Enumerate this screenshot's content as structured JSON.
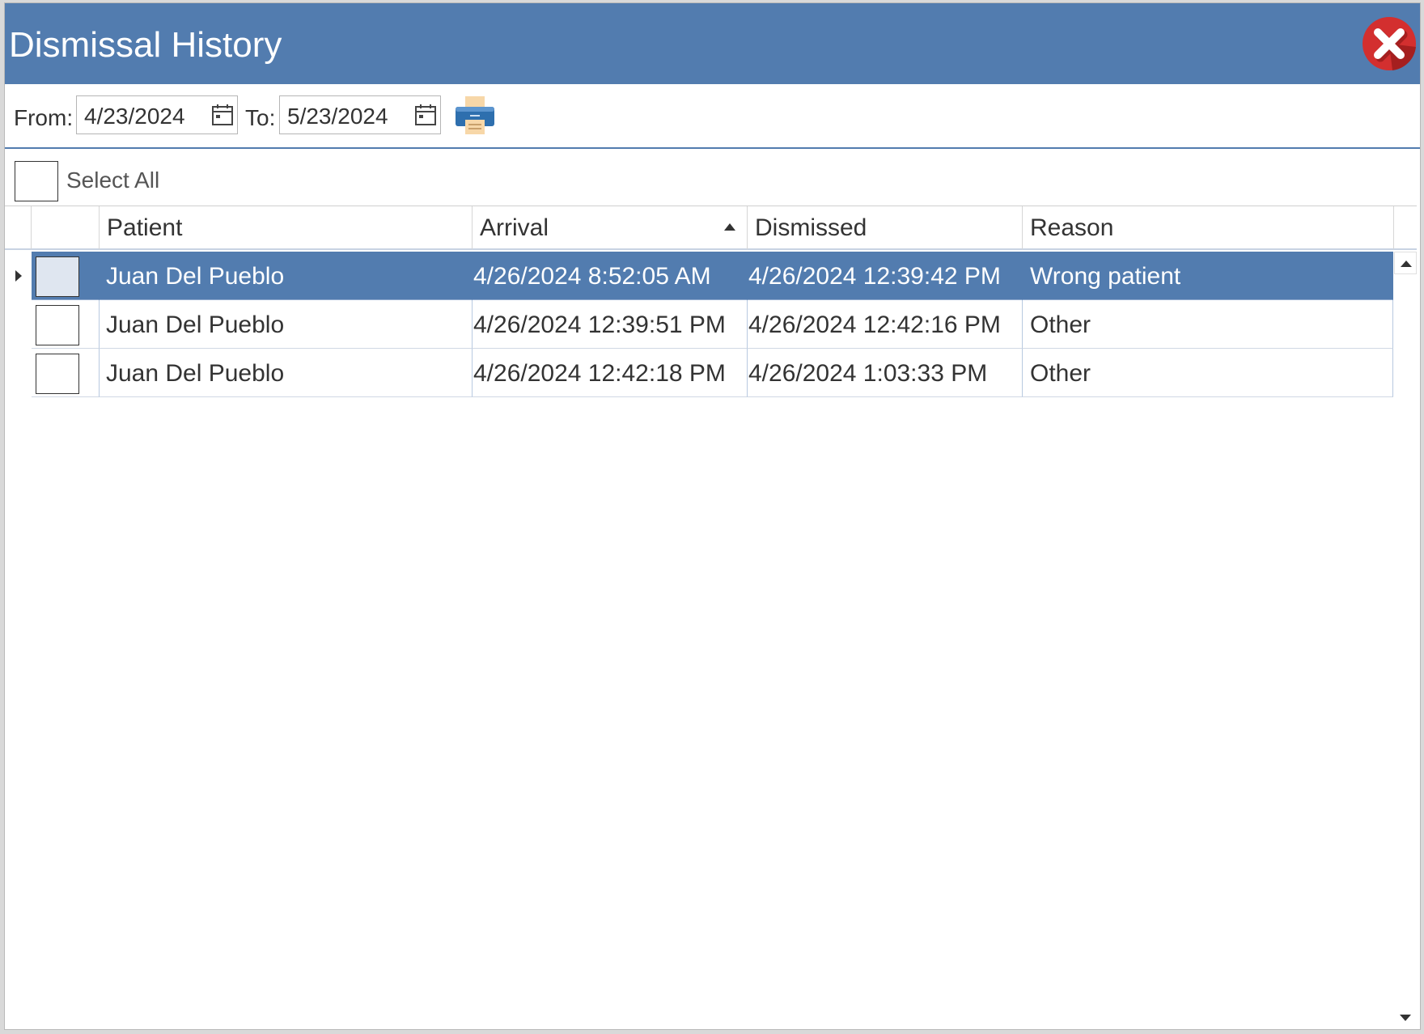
{
  "window": {
    "title": "Dismissal History"
  },
  "filters": {
    "from_label": "From:",
    "from_value": "4/23/2024",
    "to_label": "To:",
    "to_value": "5/23/2024"
  },
  "select_all_label": "Select All",
  "table": {
    "columns": [
      "Patient",
      "Arrival",
      "Dismissed",
      "Reason"
    ],
    "sorted_column": "Arrival",
    "sort_direction": "ascending",
    "rows": [
      {
        "patient": "Juan Del Pueblo",
        "arrival": "4/26/2024 8:52:05 AM",
        "dismissed": "4/26/2024 12:39:42 PM",
        "reason": "Wrong patient",
        "selected": true
      },
      {
        "patient": "Juan Del Pueblo",
        "arrival": "4/26/2024 12:39:51 PM",
        "dismissed": "4/26/2024 12:42:16 PM",
        "reason": "Other",
        "selected": false
      },
      {
        "patient": "Juan Del Pueblo",
        "arrival": "4/26/2024 12:42:18 PM",
        "dismissed": "4/26/2024 1:03:33 PM",
        "reason": "Other",
        "selected": false
      }
    ]
  },
  "icons": {
    "close": "close-icon",
    "calendar": "calendar-icon",
    "print": "printer-icon",
    "sort": "sort-ascending-icon",
    "row_indicator": "current-row-icon",
    "scroll_up": "scroll-up-icon",
    "scroll_down": "scroll-down-icon"
  },
  "colors": {
    "titlebar": "#527caf",
    "selection": "#527caf",
    "close_button": "#d32f2f"
  }
}
